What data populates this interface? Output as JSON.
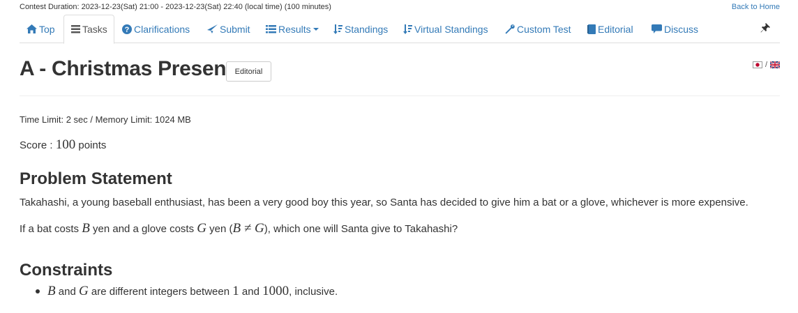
{
  "header": {
    "contest_duration": "Contest Duration: 2023-12-23(Sat) 21:00 - 2023-12-23(Sat) 22:40 (local time) (100 minutes)",
    "back_home": "Back to Home"
  },
  "nav": {
    "tabs": [
      {
        "label": "Top",
        "icon": "home-icon"
      },
      {
        "label": "Tasks",
        "icon": "list-icon",
        "active": true
      },
      {
        "label": "Clarifications",
        "icon": "question-circle-icon"
      },
      {
        "label": "Submit",
        "icon": "send-icon"
      },
      {
        "label": "Results",
        "icon": "list-icon",
        "dropdown": true
      },
      {
        "label": "Standings",
        "icon": "sort-icon"
      },
      {
        "label": "Virtual Standings",
        "icon": "sort-icon"
      },
      {
        "label": "Custom Test",
        "icon": "wrench-icon"
      },
      {
        "label": "Editorial",
        "icon": "book-icon"
      },
      {
        "label": "Discuss",
        "icon": "comment-icon"
      }
    ],
    "pin_icon": "pushpin-icon"
  },
  "problem": {
    "title": "A - Christmas Present",
    "editorial_button": "Editorial",
    "lang_separator": "/",
    "limits": "Time Limit: 2 sec / Memory Limit: 1024 MB",
    "score_label": "Score : ",
    "score_value": "100",
    "score_unit": " points",
    "statement_heading": "Problem Statement",
    "statement_p1": "Takahashi, a young baseball enthusiast, has been a very good boy this year, so Santa has decided to give him a bat or a glove, whichever is more expensive.",
    "statement_p2": {
      "t1": "If a bat costs ",
      "m1": "B",
      "t2": " yen and a glove costs ",
      "m2": "G",
      "t3": " yen (",
      "m3": "B ≠ G",
      "t4": "), which one will Santa give to Takahashi?"
    },
    "constraints_heading": "Constraints",
    "constraint_1": {
      "m1": "B",
      "t1": " and ",
      "m2": "G",
      "t2": " are different integers between ",
      "n1": "1",
      "t3": " and ",
      "n2": "1000",
      "t4": ", inclusive."
    }
  },
  "colors": {
    "link": "#337ab7",
    "text": "#333333",
    "border": "#dddddd"
  }
}
